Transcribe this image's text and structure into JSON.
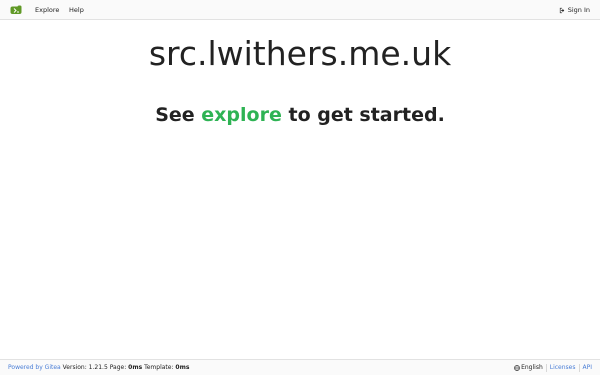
{
  "nav": {
    "logo_icon": "gitea-logo-icon",
    "explore_label": "Explore",
    "help_label": "Help",
    "signin_label": "Sign In",
    "signin_icon": "sign-in-icon"
  },
  "main": {
    "site_title": "src.lwithers.me.uk",
    "tagline_before": "See",
    "tagline_link": "explore",
    "tagline_after": "to get started."
  },
  "footer": {
    "powered_by": "Powered by Gitea",
    "version_label": "Version:",
    "version": "1.21.5",
    "page_label": "Page:",
    "page_time": "0ms",
    "template_label": "Template:",
    "template_time": "0ms",
    "language": "English",
    "language_icon": "globe-icon",
    "licenses_label": "Licenses",
    "api_label": "API"
  },
  "colors": {
    "accent_green": "#2eb354",
    "link_blue": "#4a7ed6",
    "gitea_logo_green": "#609926"
  }
}
